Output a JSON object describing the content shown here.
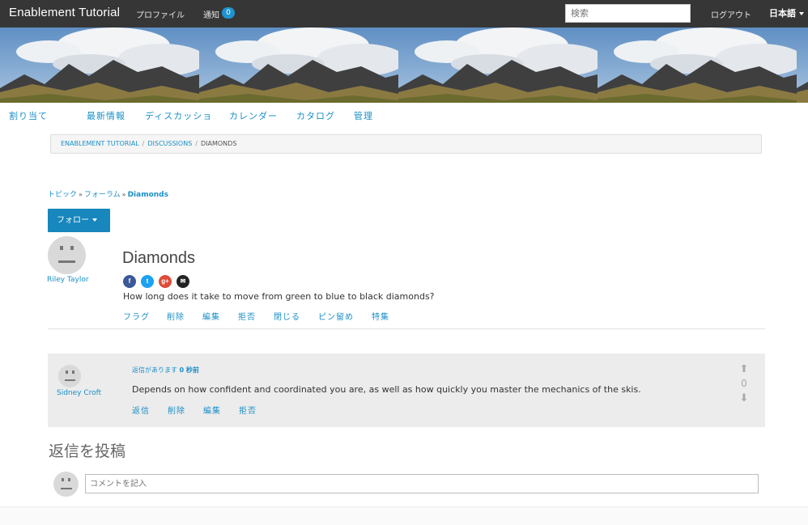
{
  "topbar": {
    "brand": "Enablement Tutorial",
    "profile": "プロファイル",
    "notifications": "通知",
    "notification_count": "0",
    "search_placeholder": "検索",
    "logout": "ログアウト",
    "language": "日本語"
  },
  "subnav": {
    "items": [
      "割り当て",
      "最新情報",
      "ディスカッショ",
      "カレンダー",
      "カタログ",
      "管理"
    ]
  },
  "breadcrumb": {
    "items": [
      "ENABLEMENT TUTORIAL",
      "DISCUSSIONS",
      "DIAMONDS"
    ]
  },
  "trail": {
    "items": [
      "トピック",
      "フォーラム",
      "Diamonds"
    ]
  },
  "follow_button": "フォロー",
  "post": {
    "author": "Riley Taylor",
    "title": "Diamonds",
    "body": "How long does it take to move from green to blue to black diamonds?",
    "social": [
      "f",
      "t",
      "g+",
      "✉"
    ],
    "actions": [
      "フラグ",
      "削除",
      "編集",
      "拒否",
      "閉じる",
      "ピン留め",
      "特集"
    ]
  },
  "reply": {
    "author": "Sidney Croft",
    "meta_prefix": "返信があります",
    "meta_time": "0 秒前",
    "body": "Depends on how confident and coordinated you are, as well as how quickly you master the mechanics of the skis.",
    "actions": [
      "返信",
      "削除",
      "編集",
      "拒否"
    ],
    "votes": "0"
  },
  "compose": {
    "title": "返信を投稿",
    "placeholder": "コメントを記入"
  },
  "colors": {
    "topbar": "#363636",
    "accent": "#1a8fc7",
    "button": "#1787bd",
    "reply_bg": "#ececec"
  }
}
